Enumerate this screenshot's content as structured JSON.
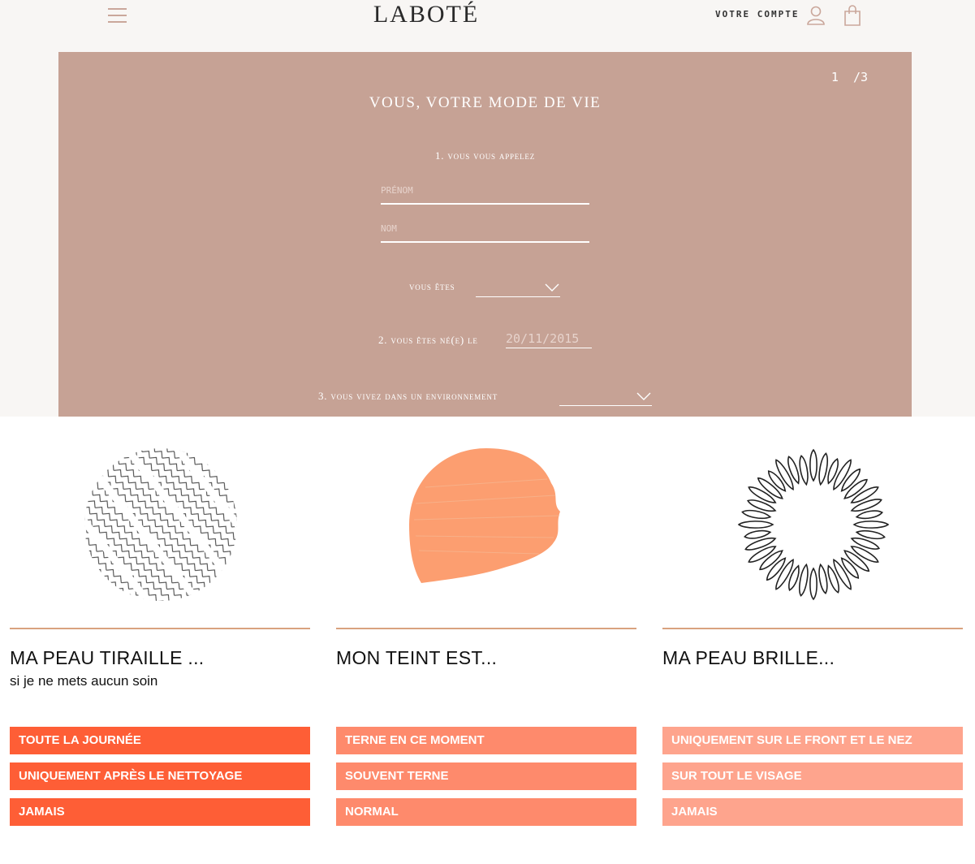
{
  "header": {
    "logo": "LABOTÉ",
    "account_label": "VOTRE COMPTE"
  },
  "questionnaire": {
    "step": "1",
    "total": "/3",
    "title": "VOUS, VOTRE MODE DE VIE",
    "q1_label": "1. vous vous appelez",
    "firstname_placeholder": "PRÉNOM",
    "lastname_placeholder": "NOM",
    "gender_label": "vous êtes",
    "q2_label": "2. vous êtes né(e) le",
    "birthdate_placeholder": "20/11/2015",
    "q3_label": "3. vous vivez dans un environnement"
  },
  "columns": [
    {
      "title": "MA PEAU TIRAILLE ...",
      "subtitle": "si je ne mets aucun soin",
      "color": "#fe5e36",
      "options": [
        "TOUTE LA JOURNÉE",
        "UNIQUEMENT APRÈS LE NETTOYAGE",
        "JAMAIS"
      ]
    },
    {
      "title": "MON TEINT EST...",
      "subtitle": "",
      "color": "#fe8a6c",
      "options": [
        "TERNE EN CE MOMENT",
        "SOUVENT TERNE",
        "NORMAL"
      ]
    },
    {
      "title": "MA PEAU BRILLE...",
      "subtitle": "",
      "color": "#fea48d",
      "options": [
        "UNIQUEMENT SUR LE FRONT ET LE NEZ",
        "SUR TOUT LE VISAGE",
        "JAMAIS"
      ]
    }
  ]
}
